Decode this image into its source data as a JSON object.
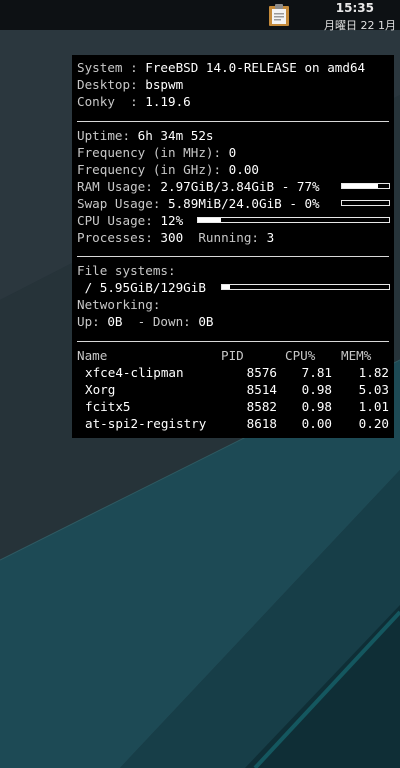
{
  "topbar": {
    "time": "15:35",
    "date": "月曜日 22 1月",
    "tray_icon": "clipboard-icon"
  },
  "conky": {
    "system_label": "System : ",
    "system_value": "FreeBSD 14.0-RELEASE on amd64",
    "desktop_label": "Desktop: ",
    "desktop_value": "bspwm",
    "conky_label": "Conky  : ",
    "conky_value": "1.19.6",
    "uptime_label": "Uptime: ",
    "uptime_value": "6h 34m 52s",
    "freq_mhz_label": "Frequency (in MHz): ",
    "freq_mhz_value": "0",
    "freq_ghz_label": "Frequency (in GHz): ",
    "freq_ghz_value": "0.00",
    "ram_label": "RAM Usage: ",
    "ram_value": "2.97GiB/3.84GiB - 77%",
    "ram_fraction": 0.77,
    "swap_label": "Swap Usage: ",
    "swap_value": "5.89MiB/24.0GiB - 0%",
    "swap_fraction": 0.0,
    "cpu_label": "CPU Usage: ",
    "cpu_value": "12%",
    "cpu_fraction": 0.12,
    "processes_label": "Processes: ",
    "processes_value": "300",
    "running_label": "  Running: ",
    "running_value": "3",
    "fs_label": "File systems:",
    "fs_value": " / 5.95GiB/129GiB",
    "fs_fraction": 0.046,
    "net_label": "Networking:",
    "up_label": "Up: ",
    "up_value": "0B",
    "down_label": "  - Down: ",
    "down_value": "0B",
    "proc_headers": {
      "name": "Name",
      "pid": "PID",
      "cpu": "CPU%",
      "mem": "MEM%"
    },
    "processes": [
      {
        "name": "xfce4-clipman",
        "pid": "8576",
        "cpu": "7.81",
        "mem": "1.82"
      },
      {
        "name": "Xorg",
        "pid": "8514",
        "cpu": "0.98",
        "mem": "5.03"
      },
      {
        "name": "fcitx5",
        "pid": "8582",
        "cpu": "0.98",
        "mem": "1.01"
      },
      {
        "name": "at-spi2-registry",
        "pid": "8618",
        "cpu": "0.00",
        "mem": "0.20"
      }
    ]
  }
}
